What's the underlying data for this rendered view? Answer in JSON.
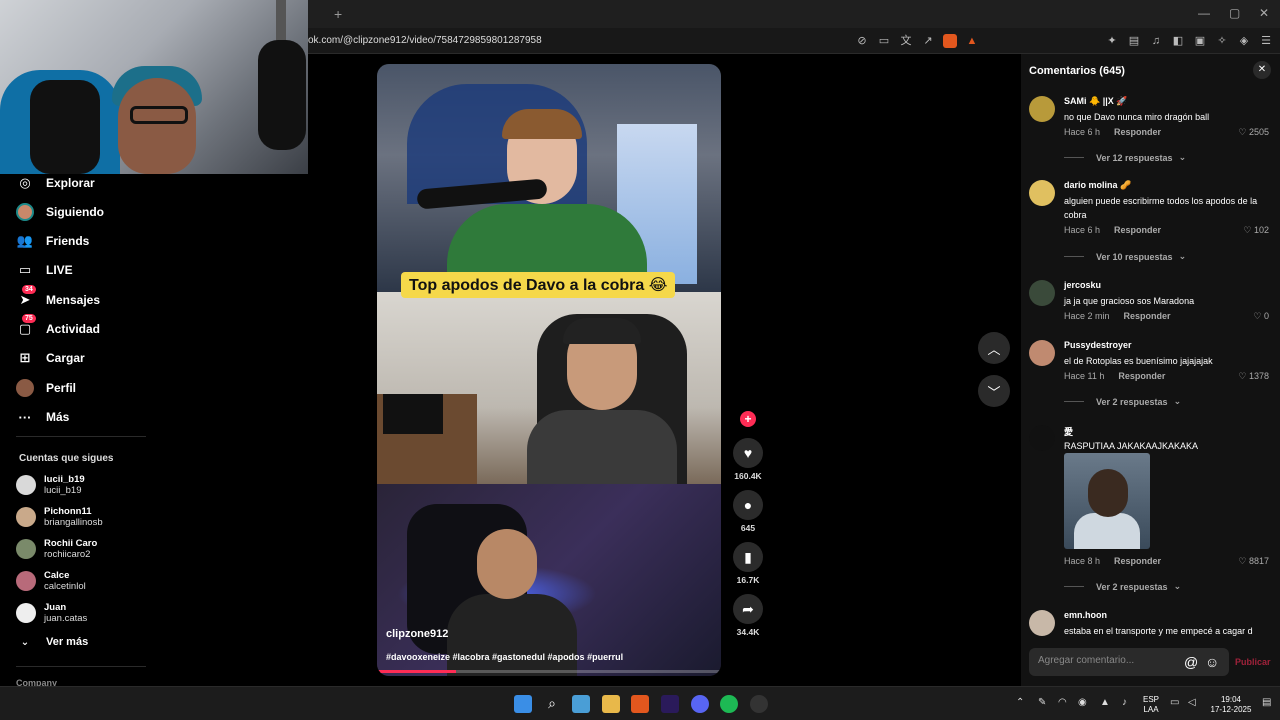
{
  "browser": {
    "url": "ok.com/@clipzone912/video/7584729859801287958",
    "tab_plus": "+",
    "win_min": "—",
    "win_max": "▢",
    "win_close": "✕"
  },
  "sidebar": {
    "nav": [
      {
        "label": "Explorar",
        "icon": "compass-icon"
      },
      {
        "label": "Siguiendo",
        "icon": "following-avatar-icon"
      },
      {
        "label": "Friends",
        "icon": "friends-icon"
      },
      {
        "label": "LIVE",
        "icon": "live-icon"
      },
      {
        "label": "Mensajes",
        "icon": "messages-icon",
        "badge": "34"
      },
      {
        "label": "Actividad",
        "icon": "activity-icon",
        "badge": "75"
      },
      {
        "label": "Cargar",
        "icon": "upload-icon"
      },
      {
        "label": "Perfil",
        "icon": "profile-icon"
      },
      {
        "label": "Más",
        "icon": "more-icon"
      }
    ],
    "following_title": "Cuentas que sigues",
    "following": [
      {
        "name": "lucii_b19",
        "user": "lucii_b19",
        "color": "#d9d9d9"
      },
      {
        "name": "Pichonn11",
        "user": "briangallinosb",
        "color": "#c9a98a"
      },
      {
        "name": "Rochii Caro",
        "user": "rochiicaro2",
        "color": "#7a8a6a"
      },
      {
        "name": "Calce",
        "user": "calcetinlol",
        "color": "#b86a7a"
      },
      {
        "name": "Juan",
        "user": "juan.catas",
        "color": "#eeeeee"
      }
    ],
    "see_more": "Ver más",
    "company": "Company"
  },
  "video": {
    "caption": "Top apodos de Davo a la cobra 😂",
    "author": "clipzone912",
    "tags": "#davooxeneize #lacobra #gastonedul #apodos #puerrul",
    "progress": 0.23
  },
  "actions": {
    "likes": "160.4K",
    "comments": "645",
    "saves": "16.7K",
    "shares": "34.4K"
  },
  "comments_panel": {
    "title": "Comentarios (645)",
    "reply_label": "Responder",
    "input_placeholder": "Agregar comentario...",
    "post_label": "Publicar",
    "items": [
      {
        "user": "SAMi 🐥 ||X 🚀",
        "text": "no que Davo nunca miro dragón ball",
        "time": "Hace 6 h",
        "likes": "2505",
        "more": "Ver 12 respuestas",
        "color": "#b89a3a"
      },
      {
        "user": "dario molina 🥜",
        "text": "alguien puede escribirme todos los apodos de la cobra",
        "time": "Hace 6 h",
        "likes": "102",
        "more": "Ver 10 respuestas",
        "color": "#e0c060"
      },
      {
        "user": "jercosku",
        "text": "ja ja que gracioso sos Maradona",
        "time": "Hace 2 min",
        "likes": "0",
        "more": "",
        "color": "#3a4a3a"
      },
      {
        "user": "Pussydestroyer",
        "text": "el de Rotoplas es buenísimo jajajajak",
        "time": "Hace 11 h",
        "likes": "1378",
        "more": "Ver 2 respuestas",
        "color": "#c08a70"
      },
      {
        "user": "愛",
        "text": "RASPUTIAA JAKAKAAJKAKAKA",
        "time": "Hace 8 h",
        "likes": "8817",
        "more": "Ver 2 respuestas",
        "color": "#111111"
      },
      {
        "user": "emn.hoon",
        "text": "estaba en el transporte y me empecé a cagar d",
        "time": "",
        "likes": "",
        "more": "",
        "color": "#c8b8a8"
      }
    ]
  },
  "taskbar": {
    "lang": "ESP",
    "region": "LAA",
    "time": "19:04",
    "date": "17-12-2025"
  },
  "colors": {
    "accent": "#fe2c55",
    "caption_bg": "#f5d84a"
  }
}
